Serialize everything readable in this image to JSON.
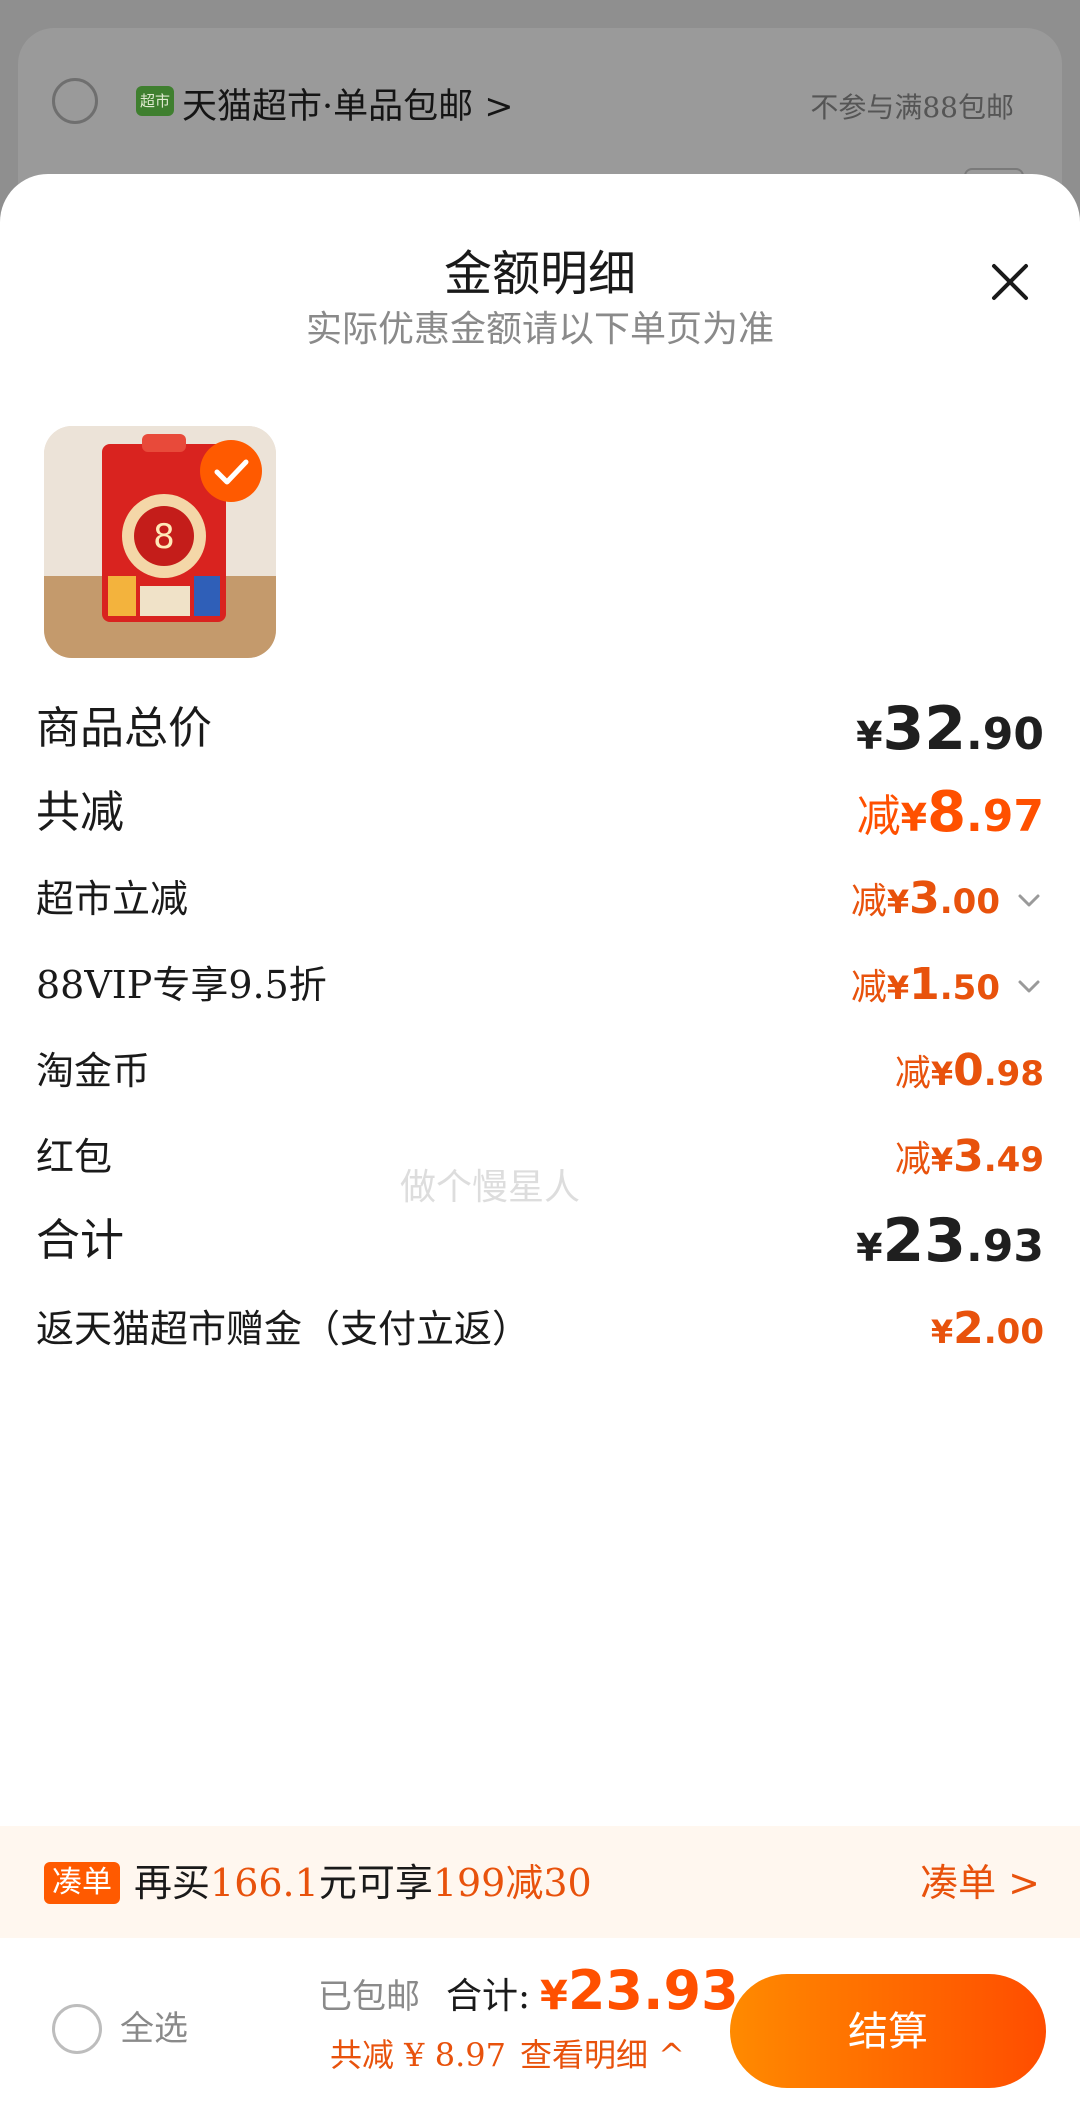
{
  "background_cart": {
    "shop_badge": "超市",
    "shop_name": "天猫超市·单品包邮 >",
    "shipping_note": "不参与满88包邮"
  },
  "sheet": {
    "title": "金额明细",
    "subtitle": "实际优惠金额请以下单页为准",
    "close_icon": "close-icon"
  },
  "rows": {
    "subtotal": {
      "label": "商品总价",
      "yen": "¥",
      "int": "32",
      "dec": ".90"
    },
    "discount_total": {
      "label": "共减",
      "prefix": "减",
      "yen": "¥",
      "int": "8",
      "dec": ".97"
    },
    "market_discount": {
      "label": "超市立减",
      "prefix": "减",
      "yen": "¥",
      "int": "3",
      "dec": ".00"
    },
    "vip_discount": {
      "label": "88VIP专享9.5折",
      "prefix": "减",
      "yen": "¥",
      "int": "1",
      "dec": ".50"
    },
    "coins": {
      "label": "淘金币",
      "prefix": "减",
      "yen": "¥",
      "int": "0",
      "dec": ".98"
    },
    "red_packet": {
      "label": "红包",
      "prefix": "减",
      "yen": "¥",
      "int": "3",
      "dec": ".49"
    },
    "total": {
      "label": "合计",
      "yen": "¥",
      "int": "23",
      "dec": ".93"
    },
    "cashback": {
      "label": "返天猫超市赠金（支付立返）",
      "yen": "¥",
      "int": "2",
      "dec": ".00"
    }
  },
  "watermark": "做个慢星人",
  "promo": {
    "badge": "凑单",
    "text_a": "再买",
    "amount": "166.1",
    "text_b": "元可享",
    "offer": "199减30",
    "link": "凑单 >"
  },
  "bottom": {
    "select_all": "全选",
    "shipping": "已包邮",
    "total_label": "合计:",
    "total_yen": "¥",
    "total_value": "23.93",
    "discount_line": "共减 ¥ 8.97",
    "details_link": "查看明细 ^",
    "checkout": "结算"
  },
  "colors": {
    "accent": "#ff5000",
    "checkout_start": "#ff8a00",
    "checkout_end": "#ff4d00"
  }
}
